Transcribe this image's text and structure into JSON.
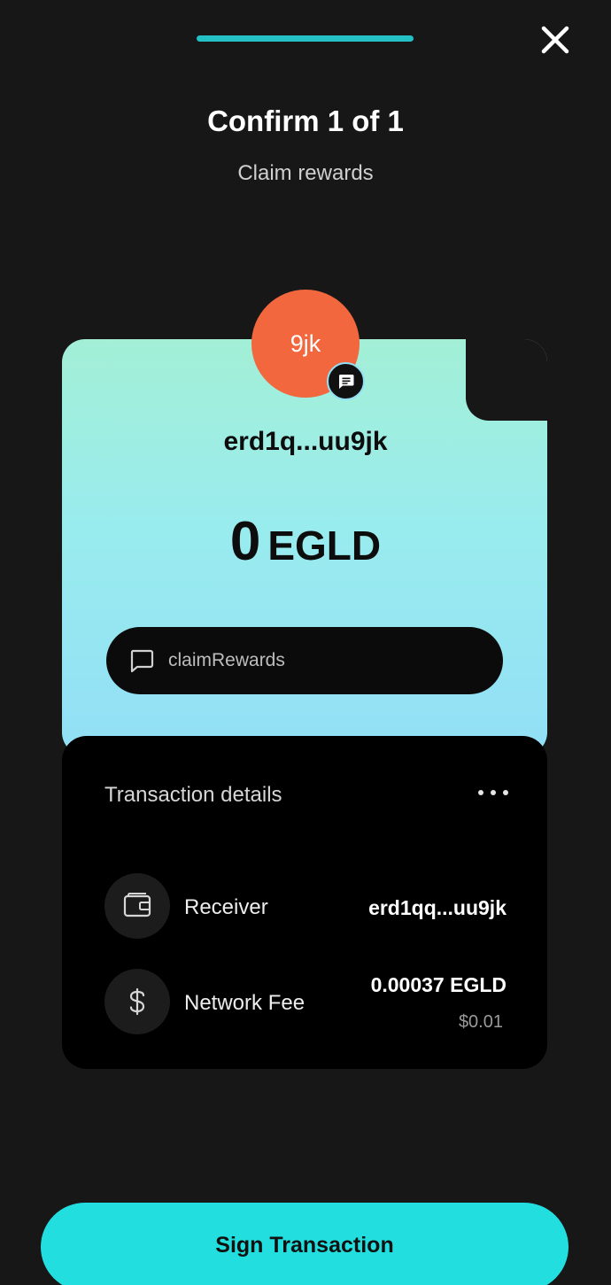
{
  "header": {
    "title": "Confirm 1 of 1",
    "subtitle": "Claim rewards"
  },
  "receiver_card": {
    "avatar_text": "9jk",
    "address": "erd1q...uu9jk",
    "amount_value": "0",
    "amount_unit": "EGLD",
    "data_label": "claimRewards"
  },
  "details": {
    "title": "Transaction details",
    "rows": [
      {
        "icon": "wallet-icon",
        "label": "Receiver",
        "value": "erd1qq...uu9jk"
      },
      {
        "icon": "dollar-icon",
        "label": "Network Fee",
        "value": "0.00037 EGLD",
        "sub": "$0.01"
      }
    ]
  },
  "actions": {
    "sign_label": "Sign Transaction"
  },
  "colors": {
    "background": "#171717",
    "accent": "#23dede",
    "avatar": "#f2673d",
    "card_gradient_top": "#a3efd6",
    "card_gradient_bottom": "#92dff6"
  }
}
